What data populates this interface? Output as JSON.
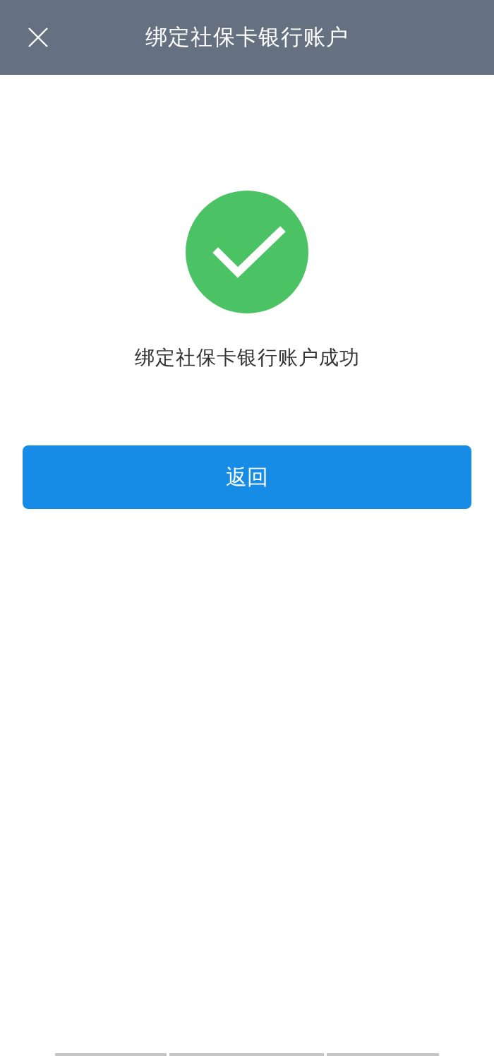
{
  "header": {
    "title": "绑定社保卡银行账户"
  },
  "result": {
    "message": "绑定社保卡银行账户成功"
  },
  "buttons": [
    {
      "label": "返回"
    }
  ]
}
